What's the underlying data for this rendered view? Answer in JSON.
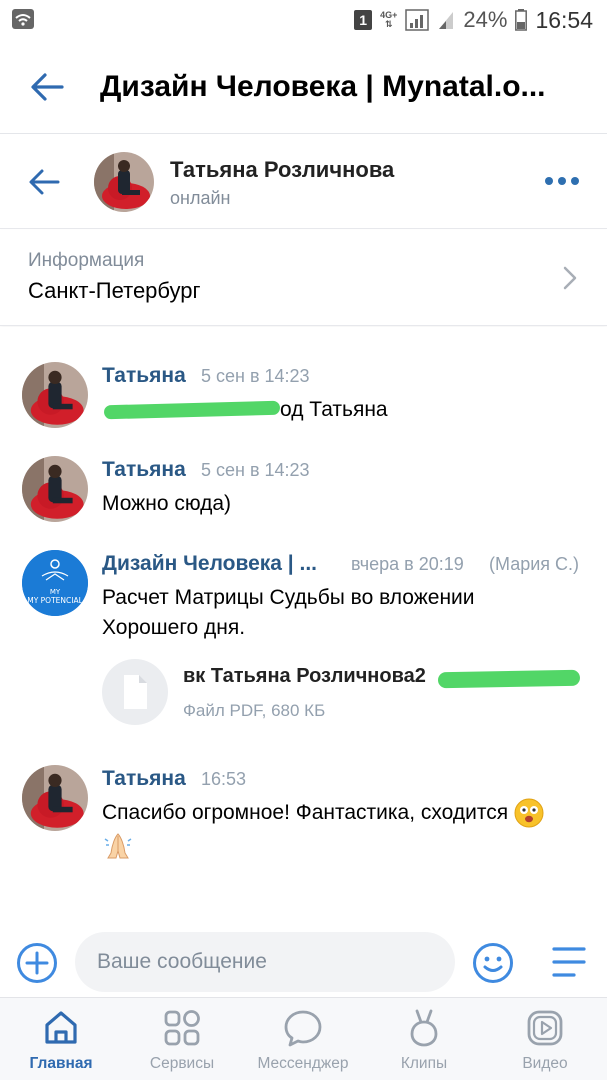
{
  "status_bar": {
    "sim": "1",
    "network": "4G+",
    "battery": "24%",
    "time": "16:54"
  },
  "header": {
    "title": "Дизайн Человека | Mynatal.o..."
  },
  "chat_header": {
    "name": "Татьяна Розличнова",
    "status": "онлайн"
  },
  "info": {
    "label": "Информация",
    "value": "Санкт-Петербург"
  },
  "messages": [
    {
      "author": "Татьяна",
      "time": "5 сен в 14:23",
      "text": "од Татьяна"
    },
    {
      "author": "Татьяна",
      "time": "5 сен в 14:23",
      "text": "Можно сюда)"
    },
    {
      "author": "Дизайн Человека | ...",
      "time": "вчера в 20:19",
      "sender_note": "(Мария С.)",
      "avatar_text": "MY POTENCIAL",
      "lines": [
        "Расчет Матрицы Судьбы во вложении",
        "Хорошего дня."
      ],
      "attachment": {
        "name": "вк Татьяна Розличнова2",
        "meta": "Файл PDF, 680 КБ"
      }
    },
    {
      "author": "Татьяна",
      "time": "16:53",
      "text": "Спасибо огромное! Фантастика, сходится"
    }
  ],
  "composer": {
    "placeholder": "Ваше сообщение"
  },
  "bottom_nav": [
    {
      "label": "Главная",
      "icon": "home-icon",
      "active": true
    },
    {
      "label": "Сервисы",
      "icon": "services-icon",
      "active": false
    },
    {
      "label": "Мессенджер",
      "icon": "messenger-icon",
      "active": false
    },
    {
      "label": "Клипы",
      "icon": "clips-icon",
      "active": false
    },
    {
      "label": "Видео",
      "icon": "video-icon",
      "active": false
    }
  ],
  "colors": {
    "accent": "#2f6ab0",
    "link": "#2a5885",
    "muted": "#818c99"
  }
}
